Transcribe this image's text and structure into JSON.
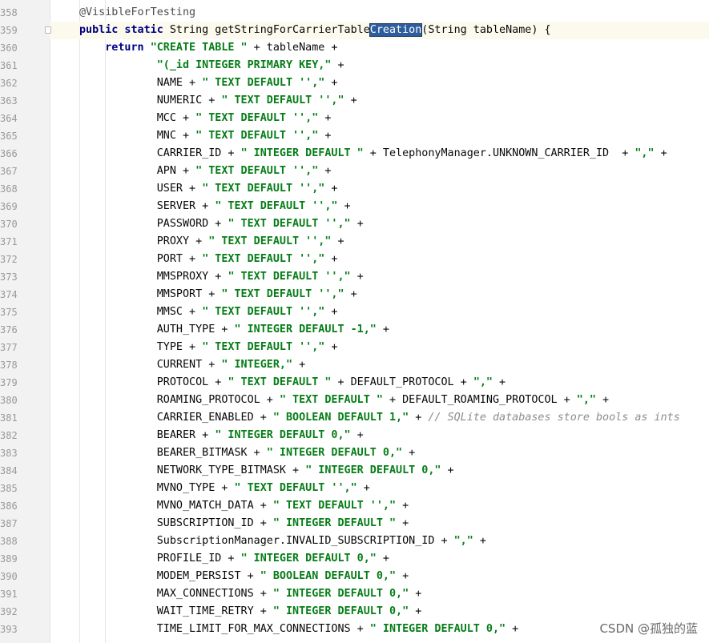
{
  "editor": {
    "lines": [
      {
        "n": "358",
        "segs": [
          {
            "t": "@VisibleForTesting",
            "c": "ann"
          }
        ]
      },
      {
        "n": "359",
        "current": true,
        "segs": [
          {
            "t": "public static ",
            "c": "kw"
          },
          {
            "t": "String getStringForCarrierTable"
          },
          {
            "t": "Creation",
            "c": "sel"
          },
          {
            "t": "(String tableName) {"
          }
        ]
      },
      {
        "n": "360",
        "indent": "    ",
        "segs": [
          {
            "t": "return ",
            "c": "kw"
          },
          {
            "t": "\"CREATE TABLE \"",
            "c": "str"
          },
          {
            "t": " + tableName +"
          }
        ]
      },
      {
        "n": "361",
        "indent": "            ",
        "segs": [
          {
            "t": "\"(_id INTEGER PRIMARY KEY,\"",
            "c": "str"
          },
          {
            "t": " +"
          }
        ]
      },
      {
        "n": "362",
        "indent": "            ",
        "segs": [
          {
            "t": "NAME + "
          },
          {
            "t": "\" TEXT DEFAULT '',\"",
            "c": "str"
          },
          {
            "t": " +"
          }
        ]
      },
      {
        "n": "363",
        "indent": "            ",
        "segs": [
          {
            "t": "NUMERIC + "
          },
          {
            "t": "\" TEXT DEFAULT '',\"",
            "c": "str"
          },
          {
            "t": " +"
          }
        ]
      },
      {
        "n": "364",
        "indent": "            ",
        "segs": [
          {
            "t": "MCC + "
          },
          {
            "t": "\" TEXT DEFAULT '',\"",
            "c": "str"
          },
          {
            "t": " +"
          }
        ]
      },
      {
        "n": "365",
        "indent": "            ",
        "segs": [
          {
            "t": "MNC + "
          },
          {
            "t": "\" TEXT DEFAULT '',\"",
            "c": "str"
          },
          {
            "t": " +"
          }
        ]
      },
      {
        "n": "366",
        "indent": "            ",
        "segs": [
          {
            "t": "CARRIER_ID + "
          },
          {
            "t": "\" INTEGER DEFAULT \"",
            "c": "str"
          },
          {
            "t": " + TelephonyManager.UNKNOWN_CARRIER_ID  + "
          },
          {
            "t": "\",\"",
            "c": "str"
          },
          {
            "t": " +"
          }
        ]
      },
      {
        "n": "367",
        "indent": "            ",
        "segs": [
          {
            "t": "APN + "
          },
          {
            "t": "\" TEXT DEFAULT '',\"",
            "c": "str"
          },
          {
            "t": " +"
          }
        ]
      },
      {
        "n": "368",
        "indent": "            ",
        "segs": [
          {
            "t": "USER + "
          },
          {
            "t": "\" TEXT DEFAULT '',\"",
            "c": "str"
          },
          {
            "t": " +"
          }
        ]
      },
      {
        "n": "369",
        "indent": "            ",
        "segs": [
          {
            "t": "SERVER + "
          },
          {
            "t": "\" TEXT DEFAULT '',\"",
            "c": "str"
          },
          {
            "t": " +"
          }
        ]
      },
      {
        "n": "370",
        "indent": "            ",
        "segs": [
          {
            "t": "PASSWORD + "
          },
          {
            "t": "\" TEXT DEFAULT '',\"",
            "c": "str"
          },
          {
            "t": " +"
          }
        ]
      },
      {
        "n": "371",
        "indent": "            ",
        "segs": [
          {
            "t": "PROXY + "
          },
          {
            "t": "\" TEXT DEFAULT '',\"",
            "c": "str"
          },
          {
            "t": " +"
          }
        ]
      },
      {
        "n": "372",
        "indent": "            ",
        "segs": [
          {
            "t": "PORT + "
          },
          {
            "t": "\" TEXT DEFAULT '',\"",
            "c": "str"
          },
          {
            "t": " +"
          }
        ]
      },
      {
        "n": "373",
        "indent": "            ",
        "segs": [
          {
            "t": "MMSPROXY + "
          },
          {
            "t": "\" TEXT DEFAULT '',\"",
            "c": "str"
          },
          {
            "t": " +"
          }
        ]
      },
      {
        "n": "374",
        "indent": "            ",
        "segs": [
          {
            "t": "MMSPORT + "
          },
          {
            "t": "\" TEXT DEFAULT '',\"",
            "c": "str"
          },
          {
            "t": " +"
          }
        ]
      },
      {
        "n": "375",
        "indent": "            ",
        "segs": [
          {
            "t": "MMSC + "
          },
          {
            "t": "\" TEXT DEFAULT '',\"",
            "c": "str"
          },
          {
            "t": " +"
          }
        ]
      },
      {
        "n": "376",
        "indent": "            ",
        "segs": [
          {
            "t": "AUTH_TYPE + "
          },
          {
            "t": "\" INTEGER DEFAULT -1,\"",
            "c": "str"
          },
          {
            "t": " +"
          }
        ]
      },
      {
        "n": "377",
        "indent": "            ",
        "segs": [
          {
            "t": "TYPE + "
          },
          {
            "t": "\" TEXT DEFAULT '',\"",
            "c": "str"
          },
          {
            "t": " +"
          }
        ]
      },
      {
        "n": "378",
        "indent": "            ",
        "segs": [
          {
            "t": "CURRENT + "
          },
          {
            "t": "\" INTEGER,\"",
            "c": "str"
          },
          {
            "t": " +"
          }
        ]
      },
      {
        "n": "379",
        "indent": "            ",
        "segs": [
          {
            "t": "PROTOCOL + "
          },
          {
            "t": "\" TEXT DEFAULT \"",
            "c": "str"
          },
          {
            "t": " + DEFAULT_PROTOCOL + "
          },
          {
            "t": "\",\"",
            "c": "str"
          },
          {
            "t": " +"
          }
        ]
      },
      {
        "n": "380",
        "indent": "            ",
        "segs": [
          {
            "t": "ROAMING_PROTOCOL + "
          },
          {
            "t": "\" TEXT DEFAULT \"",
            "c": "str"
          },
          {
            "t": " + DEFAULT_ROAMING_PROTOCOL + "
          },
          {
            "t": "\",\"",
            "c": "str"
          },
          {
            "t": " +"
          }
        ]
      },
      {
        "n": "381",
        "indent": "            ",
        "segs": [
          {
            "t": "CARRIER_ENABLED + "
          },
          {
            "t": "\" BOOLEAN DEFAULT 1,\"",
            "c": "str"
          },
          {
            "t": " + "
          },
          {
            "t": "// SQLite databases store bools as ints",
            "c": "cmt"
          }
        ]
      },
      {
        "n": "382",
        "indent": "            ",
        "segs": [
          {
            "t": "BEARER + "
          },
          {
            "t": "\" INTEGER DEFAULT 0,\"",
            "c": "str"
          },
          {
            "t": " +"
          }
        ]
      },
      {
        "n": "383",
        "indent": "            ",
        "segs": [
          {
            "t": "BEARER_BITMASK + "
          },
          {
            "t": "\" INTEGER DEFAULT 0,\"",
            "c": "str"
          },
          {
            "t": " +"
          }
        ]
      },
      {
        "n": "384",
        "indent": "            ",
        "segs": [
          {
            "t": "NETWORK_TYPE_BITMASK + "
          },
          {
            "t": "\" INTEGER DEFAULT 0,\"",
            "c": "str"
          },
          {
            "t": " +"
          }
        ]
      },
      {
        "n": "385",
        "indent": "            ",
        "segs": [
          {
            "t": "MVNO_TYPE + "
          },
          {
            "t": "\" TEXT DEFAULT '',\"",
            "c": "str"
          },
          {
            "t": " +"
          }
        ]
      },
      {
        "n": "386",
        "indent": "            ",
        "segs": [
          {
            "t": "MVNO_MATCH_DATA + "
          },
          {
            "t": "\" TEXT DEFAULT '',\"",
            "c": "str"
          },
          {
            "t": " +"
          }
        ]
      },
      {
        "n": "387",
        "indent": "            ",
        "segs": [
          {
            "t": "SUBSCRIPTION_ID + "
          },
          {
            "t": "\" INTEGER DEFAULT \"",
            "c": "str"
          },
          {
            "t": " +"
          }
        ]
      },
      {
        "n": "388",
        "indent": "            ",
        "segs": [
          {
            "t": "SubscriptionManager.INVALID_SUBSCRIPTION_ID + "
          },
          {
            "t": "\",\"",
            "c": "str"
          },
          {
            "t": " +"
          }
        ]
      },
      {
        "n": "389",
        "indent": "            ",
        "segs": [
          {
            "t": "PROFILE_ID + "
          },
          {
            "t": "\" INTEGER DEFAULT 0,\"",
            "c": "str"
          },
          {
            "t": " +"
          }
        ]
      },
      {
        "n": "390",
        "indent": "            ",
        "segs": [
          {
            "t": "MODEM_PERSIST + "
          },
          {
            "t": "\" BOOLEAN DEFAULT 0,\"",
            "c": "str"
          },
          {
            "t": " +"
          }
        ]
      },
      {
        "n": "391",
        "indent": "            ",
        "segs": [
          {
            "t": "MAX_CONNECTIONS + "
          },
          {
            "t": "\" INTEGER DEFAULT 0,\"",
            "c": "str"
          },
          {
            "t": " +"
          }
        ]
      },
      {
        "n": "392",
        "indent": "            ",
        "segs": [
          {
            "t": "WAIT_TIME_RETRY + "
          },
          {
            "t": "\" INTEGER DEFAULT 0,\"",
            "c": "str"
          },
          {
            "t": " +"
          }
        ]
      },
      {
        "n": "393",
        "indent": "            ",
        "segs": [
          {
            "t": "TIME_LIMIT_FOR_MAX_CONNECTIONS + "
          },
          {
            "t": "\" INTEGER DEFAULT 0,\"",
            "c": "str"
          },
          {
            "t": " +"
          }
        ]
      }
    ]
  },
  "watermark": "CSDN @孤独的蓝",
  "colors": {
    "keyword": "#000080",
    "string": "#067d17",
    "comment": "#8c8c8c",
    "selection": "#2e5d9e",
    "gutter": "#f2f2f2",
    "current_line": "#fcfaed"
  }
}
